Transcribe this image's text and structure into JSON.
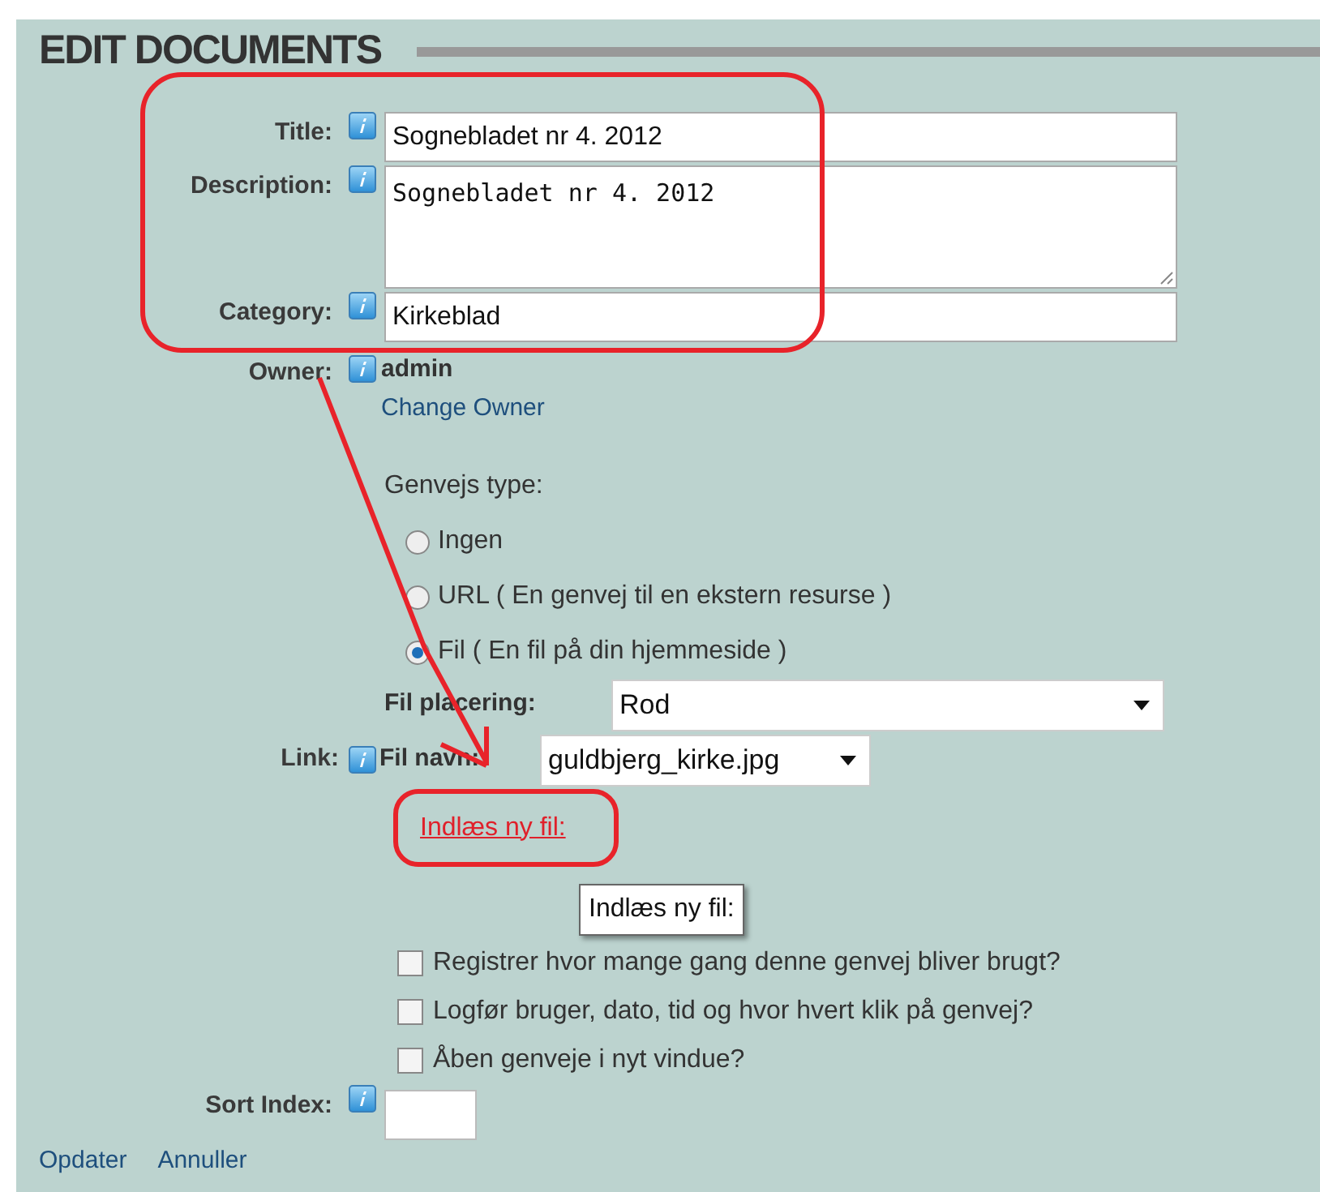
{
  "heading": "EDIT DOCUMENTS",
  "fields": [
    {
      "label": "Title:",
      "value": "Sognebladet nr 4. 2012",
      "kind": "text"
    },
    {
      "label": "Description:",
      "value": "Sognebladet nr 4. 2012",
      "kind": "textarea"
    },
    {
      "label": "Category:",
      "value": "Kirkeblad",
      "kind": "text"
    }
  ],
  "owner": {
    "label": "Owner:",
    "value": "admin",
    "link": "Change Owner"
  },
  "shortcut_type": {
    "label": "Genvejs type:",
    "options": [
      {
        "label": "Ingen",
        "selected": false
      },
      {
        "label": "URL ( En genvej til en ekstern resurse )",
        "selected": false
      },
      {
        "label": "Fil ( En fil på din hjemmeside )",
        "selected": true
      }
    ]
  },
  "file_location": {
    "label": "Fil placering:",
    "value": "Rod"
  },
  "link": {
    "label": "Link:",
    "file_name_label": "Fil navn:",
    "file_name": "guldbjerg_kirke.jpg",
    "upload_link": "Indlæs ny fil:",
    "tooltip": "Indlæs ny fil:"
  },
  "options": [
    {
      "label": "Registrer hvor mange gang denne genvej bliver brugt?",
      "checked": false
    },
    {
      "label": "Logfør bruger, dato, tid og hvor hvert klik på genvej?",
      "checked": false
    },
    {
      "label": "Åben genveje i nyt vindue?",
      "checked": false
    }
  ],
  "sort_index": {
    "label": "Sort Index:"
  },
  "actions": [
    "Opdater",
    "Annuller"
  ]
}
